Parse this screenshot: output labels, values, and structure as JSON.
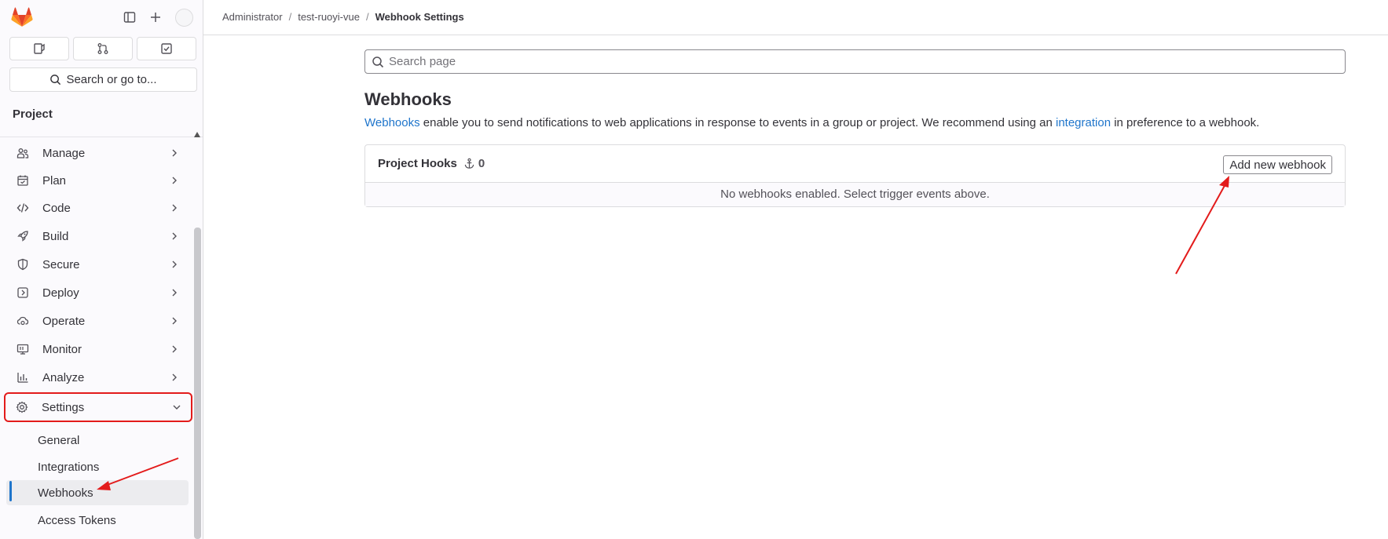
{
  "sidebar": {
    "search_label": "Search or go to...",
    "section_title": "Project",
    "items": [
      {
        "label": "Manage",
        "icon": "users-icon"
      },
      {
        "label": "Plan",
        "icon": "calendar-icon"
      },
      {
        "label": "Code",
        "icon": "code-icon"
      },
      {
        "label": "Build",
        "icon": "rocket-icon"
      },
      {
        "label": "Secure",
        "icon": "shield-icon"
      },
      {
        "label": "Deploy",
        "icon": "deployments-icon"
      },
      {
        "label": "Operate",
        "icon": "cloud-icon"
      },
      {
        "label": "Monitor",
        "icon": "monitor-icon"
      },
      {
        "label": "Analyze",
        "icon": "chart-icon"
      },
      {
        "label": "Settings",
        "icon": "gear-icon"
      }
    ],
    "settings_sub": [
      {
        "label": "General"
      },
      {
        "label": "Integrations"
      },
      {
        "label": "Webhooks"
      },
      {
        "label": "Access Tokens"
      }
    ]
  },
  "breadcrumb": {
    "items": [
      "Administrator",
      "test-ruoyi-vue",
      "Webhook Settings"
    ]
  },
  "search": {
    "placeholder": "Search page"
  },
  "main": {
    "title": "Webhooks",
    "desc_link1": "Webhooks",
    "desc_mid": " enable you to send notifications to web applications in response to events in a group or project. We recommend using an ",
    "desc_link2": "integration",
    "desc_end": " in preference to a webhook.",
    "hooks_title": "Project Hooks",
    "hooks_count": "0",
    "add_button": "Add new webhook",
    "empty_message": "No webhooks enabled. Select trigger events above."
  },
  "colors": {
    "accent": "#1f75cb",
    "annotation": "#e31b1b",
    "logo": "#e24329"
  }
}
